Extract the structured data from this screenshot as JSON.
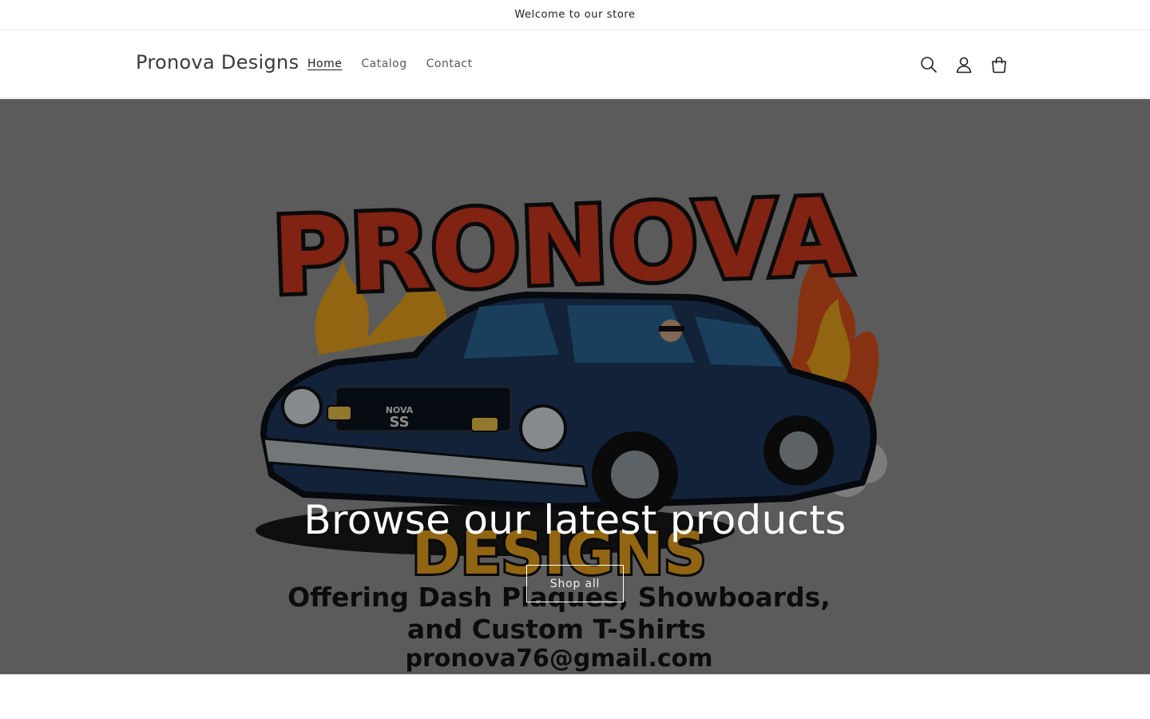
{
  "announcement": {
    "text": "Welcome to our store"
  },
  "header": {
    "brand": "Pronova Designs",
    "nav": [
      {
        "label": "Home",
        "active": true
      },
      {
        "label": "Catalog",
        "active": false
      },
      {
        "label": "Contact",
        "active": false
      }
    ],
    "icons": [
      "search-icon",
      "account-icon",
      "cart-icon"
    ]
  },
  "hero": {
    "title": "Browse our latest products",
    "button_label": "Shop all",
    "logo_artwork": {
      "headline": "PRONOVA",
      "subheadline": "DESIGNS",
      "car_badge_line1": "NOVA",
      "car_badge_line2": "SS",
      "tagline_line1": "Offering Dash Plaques, Showboards,",
      "tagline_line2": "and Custom T-Shirts",
      "email": "pronova76@gmail.com"
    }
  },
  "colors": {
    "hero_background": "#989898",
    "logo_red": "#d63b1f",
    "logo_yellow": "#f2a81d",
    "car_blue": "#1e3a5f"
  }
}
